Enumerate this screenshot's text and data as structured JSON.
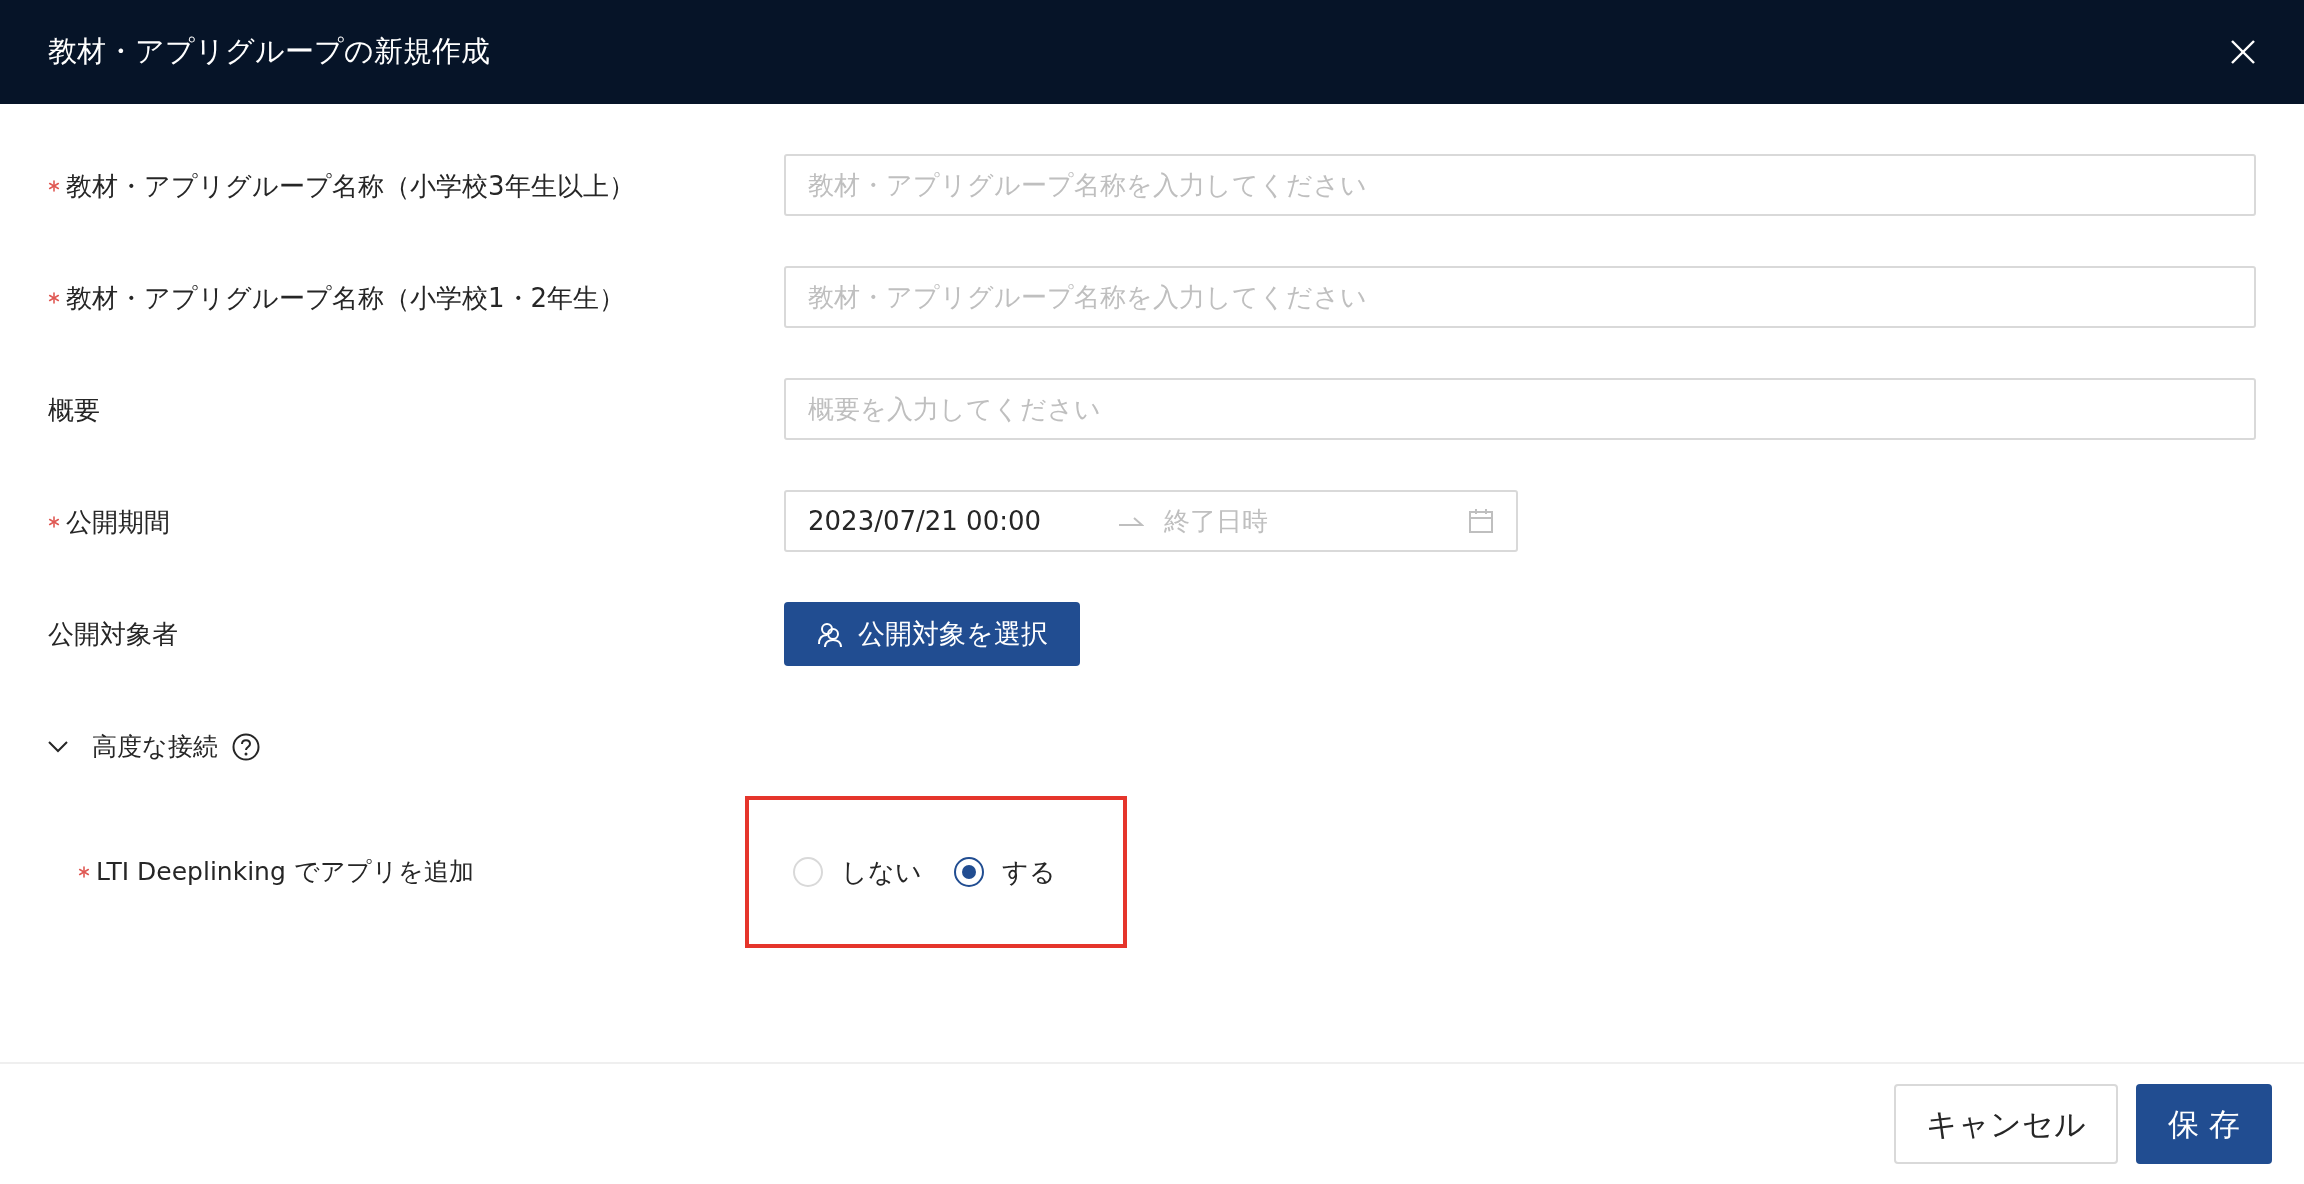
{
  "dialog": {
    "title": "教材・アプリグループの新規作成"
  },
  "fields": [
    {
      "kind": "text",
      "label": "教材・アプリグループ名称（小学校3年生以上）",
      "required": true,
      "placeholder": "教材・アプリグループ名称を入力してください"
    },
    {
      "kind": "text",
      "label": "教材・アプリグループ名称（小学校1・2年生）",
      "required": true,
      "placeholder": "教材・アプリグループ名称を入力してください"
    },
    {
      "kind": "text",
      "label": "概要",
      "required": false,
      "placeholder": "概要を入力してください"
    },
    {
      "kind": "daterange",
      "label": "公開期間",
      "required": true,
      "start_value": "2023/07/21 00:00",
      "end_placeholder": "終了日時"
    },
    {
      "kind": "button",
      "label": "公開対象者",
      "required": false,
      "button_label": "公開対象を選択"
    }
  ],
  "advanced": {
    "title": "高度な接続",
    "expanded": true,
    "field": {
      "label": "LTI Deeplinking でアプリを追加",
      "required": true,
      "options": [
        {
          "label": "しない",
          "selected": false
        },
        {
          "label": "する",
          "selected": true
        }
      ]
    }
  },
  "footer": {
    "buttons": [
      {
        "kind": "secondary",
        "label": "キャンセル"
      },
      {
        "kind": "primary",
        "label": "保 存"
      }
    ]
  }
}
